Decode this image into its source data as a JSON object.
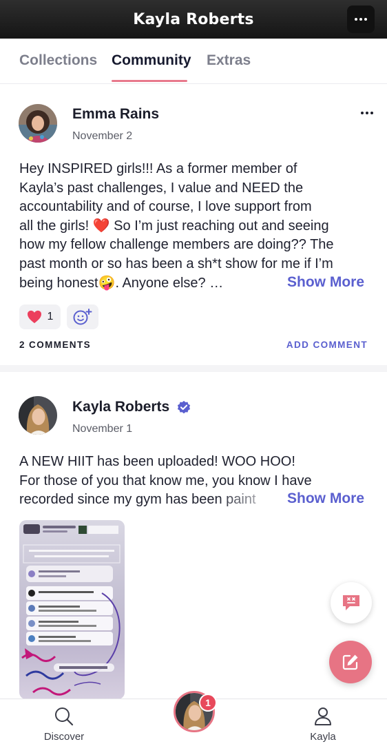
{
  "header": {
    "title": "Kayla Roberts"
  },
  "tabs": [
    {
      "label": "Collections"
    },
    {
      "label": "Community"
    },
    {
      "label": "Extras"
    }
  ],
  "posts": [
    {
      "author": "Emma Rains",
      "date": "November 2",
      "lines": [
        "Hey INSPIRED girls!!! As a former member of",
        "Kayla’s past challenges, I value and NEED the",
        "accountability and of course, I love support from",
        "all the girls! ❤️ So I’m just reaching out and seeing",
        "how my fellow challenge members are doing?? The",
        "past month or so has been a sh*t show for me if I’m",
        "being honest🤪. Anyone else? …"
      ],
      "show_more": "Show More",
      "reaction_count": "1",
      "comments_label": "2 COMMENTS",
      "add_comment_label": "ADD COMMENT"
    },
    {
      "author": "Kayla Roberts",
      "verified": true,
      "date": "November 1",
      "lines": [
        "A NEW HIIT has been uploaded! WOO HOO!",
        "For those of you that know me, you know I have",
        "recorded since my gym has been paint"
      ],
      "show_more": "Show More"
    }
  ],
  "bottom_nav": {
    "discover_label": "Discover",
    "profile_label": "Kayla",
    "badge_count": "1"
  },
  "colors": {
    "accent": "#5a5fcf",
    "pink": "#e77484",
    "badge": "#e8495b"
  }
}
